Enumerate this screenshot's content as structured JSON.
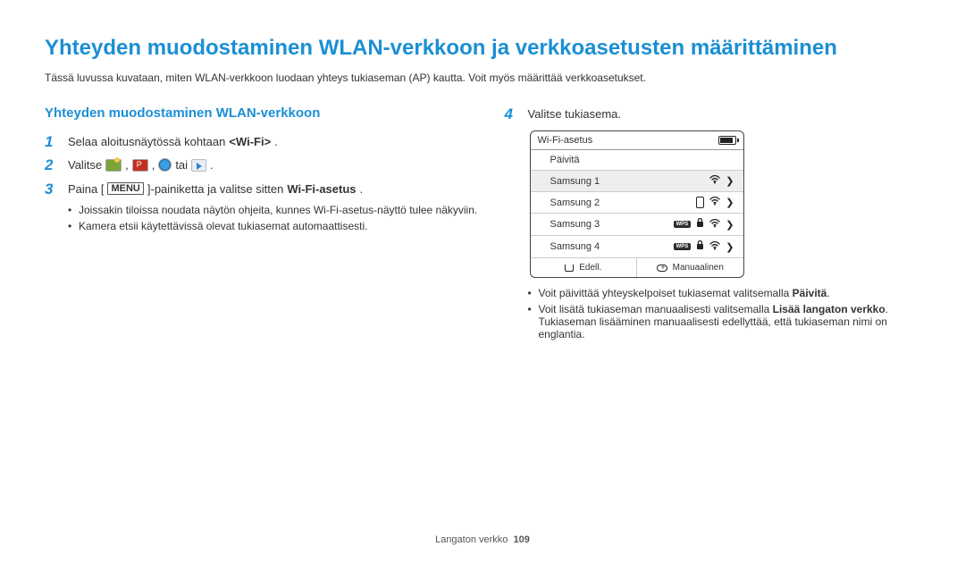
{
  "title": "Yhteyden muodostaminen WLAN-verkkoon ja verkkoasetusten määrittäminen",
  "intro": "Tässä luvussa kuvataan, miten WLAN-verkkoon luodaan yhteys tukiaseman (AP) kautta. Voit myös määrittää verkkoasetukset.",
  "left": {
    "subhead": "Yhteyden muodostaminen WLAN-verkkoon",
    "step1_num": "1",
    "step1_pre": "Selaa aloitusnäytössä kohtaan ",
    "step1_bold": "<Wi-Fi>",
    "step1_suf": ".",
    "step2_num": "2",
    "step2_pre": "Valitse ",
    "step2_mid1": ", ",
    "step2_mid2": ", ",
    "step2_mid3": " tai ",
    "step2_suf": ".",
    "step3_num": "3",
    "step3_pre": "Paina [",
    "step3_menu": "MENU",
    "step3_mid": "]-painiketta ja valitse sitten ",
    "step3_bold": "Wi-Fi-asetus",
    "step3_suf": ".",
    "bullets": [
      "Joissakin tiloissa noudata näytön ohjeita, kunnes Wi-Fi-asetus-näyttö tulee näkyviin.",
      "Kamera etsii käytettävissä olevat tukiasemat automaattisesti."
    ]
  },
  "right": {
    "step4_num": "4",
    "step4_text": "Valitse tukiasema.",
    "panel": {
      "head": "Wi-Fi-asetus",
      "refresh": "Päivitä",
      "rows": [
        "Samsung 1",
        "Samsung 2",
        "Samsung 3",
        "Samsung 4"
      ],
      "back": "Edell.",
      "manual": "Manuaalinen"
    },
    "bullets_b1_pre": "Voit päivittää yhteyskelpoiset tukiasemat valitsemalla ",
    "bullets_b1_bold": "Päivitä",
    "bullets_b1_suf": ".",
    "bullets_b2_pre": "Voit lisätä tukiaseman manuaalisesti valitsemalla ",
    "bullets_b2_bold": "Lisää langaton verkko",
    "bullets_b2_suf": ". Tukiaseman lisääminen manuaalisesti edellyttää, että tukiaseman nimi on englantia."
  },
  "footer_section": "Langaton verkko",
  "footer_page": "109"
}
